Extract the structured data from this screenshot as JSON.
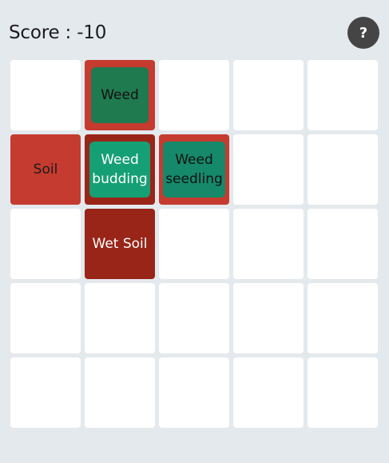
{
  "header": {
    "score_text": "Score : -10",
    "help_label": "?"
  },
  "grid": {
    "rows": 5,
    "cols": 5,
    "cells": [
      {
        "row": 0,
        "col": 0,
        "state": "empty",
        "soil_label": "",
        "plant_label": ""
      },
      {
        "row": 0,
        "col": 1,
        "state": "soil",
        "soil_label": "",
        "plant_label": "Weed",
        "plant_type": "weed"
      },
      {
        "row": 0,
        "col": 2,
        "state": "empty",
        "soil_label": "",
        "plant_label": ""
      },
      {
        "row": 0,
        "col": 3,
        "state": "empty",
        "soil_label": "",
        "plant_label": ""
      },
      {
        "row": 0,
        "col": 4,
        "state": "empty",
        "soil_label": "",
        "plant_label": ""
      },
      {
        "row": 1,
        "col": 0,
        "state": "soil",
        "soil_label": "Soil",
        "plant_label": ""
      },
      {
        "row": 1,
        "col": 1,
        "state": "wet-soil",
        "soil_label": "",
        "plant_label": "Weed budding",
        "plant_type": "budding"
      },
      {
        "row": 1,
        "col": 2,
        "state": "soil",
        "soil_label": "",
        "plant_label": "Weed seedling",
        "plant_type": "seedling"
      },
      {
        "row": 1,
        "col": 3,
        "state": "empty",
        "soil_label": "",
        "plant_label": ""
      },
      {
        "row": 1,
        "col": 4,
        "state": "empty",
        "soil_label": "",
        "plant_label": ""
      },
      {
        "row": 2,
        "col": 0,
        "state": "empty",
        "soil_label": "",
        "plant_label": ""
      },
      {
        "row": 2,
        "col": 1,
        "state": "wet-soil",
        "soil_label": "Wet Soil",
        "plant_label": ""
      },
      {
        "row": 2,
        "col": 2,
        "state": "empty",
        "soil_label": "",
        "plant_label": ""
      },
      {
        "row": 2,
        "col": 3,
        "state": "empty",
        "soil_label": "",
        "plant_label": ""
      },
      {
        "row": 2,
        "col": 4,
        "state": "empty",
        "soil_label": "",
        "plant_label": ""
      },
      {
        "row": 3,
        "col": 0,
        "state": "empty",
        "soil_label": "",
        "plant_label": ""
      },
      {
        "row": 3,
        "col": 1,
        "state": "empty",
        "soil_label": "",
        "plant_label": ""
      },
      {
        "row": 3,
        "col": 2,
        "state": "empty",
        "soil_label": "",
        "plant_label": ""
      },
      {
        "row": 3,
        "col": 3,
        "state": "empty",
        "soil_label": "",
        "plant_label": ""
      },
      {
        "row": 3,
        "col": 4,
        "state": "empty",
        "soil_label": "",
        "plant_label": ""
      },
      {
        "row": 4,
        "col": 0,
        "state": "empty",
        "soil_label": "",
        "plant_label": ""
      },
      {
        "row": 4,
        "col": 1,
        "state": "empty",
        "soil_label": "",
        "plant_label": ""
      },
      {
        "row": 4,
        "col": 2,
        "state": "empty",
        "soil_label": "",
        "plant_label": ""
      },
      {
        "row": 4,
        "col": 3,
        "state": "empty",
        "soil_label": "",
        "plant_label": ""
      },
      {
        "row": 4,
        "col": 4,
        "state": "empty",
        "soil_label": "",
        "plant_label": ""
      }
    ]
  },
  "colors": {
    "background": "#e4e9ee",
    "soil": "#c63b2f",
    "wet_soil": "#982518",
    "weed": "#1f7a4f",
    "weed_budding": "#159f74",
    "weed_seedling": "#15896a",
    "help_button": "#454545"
  }
}
